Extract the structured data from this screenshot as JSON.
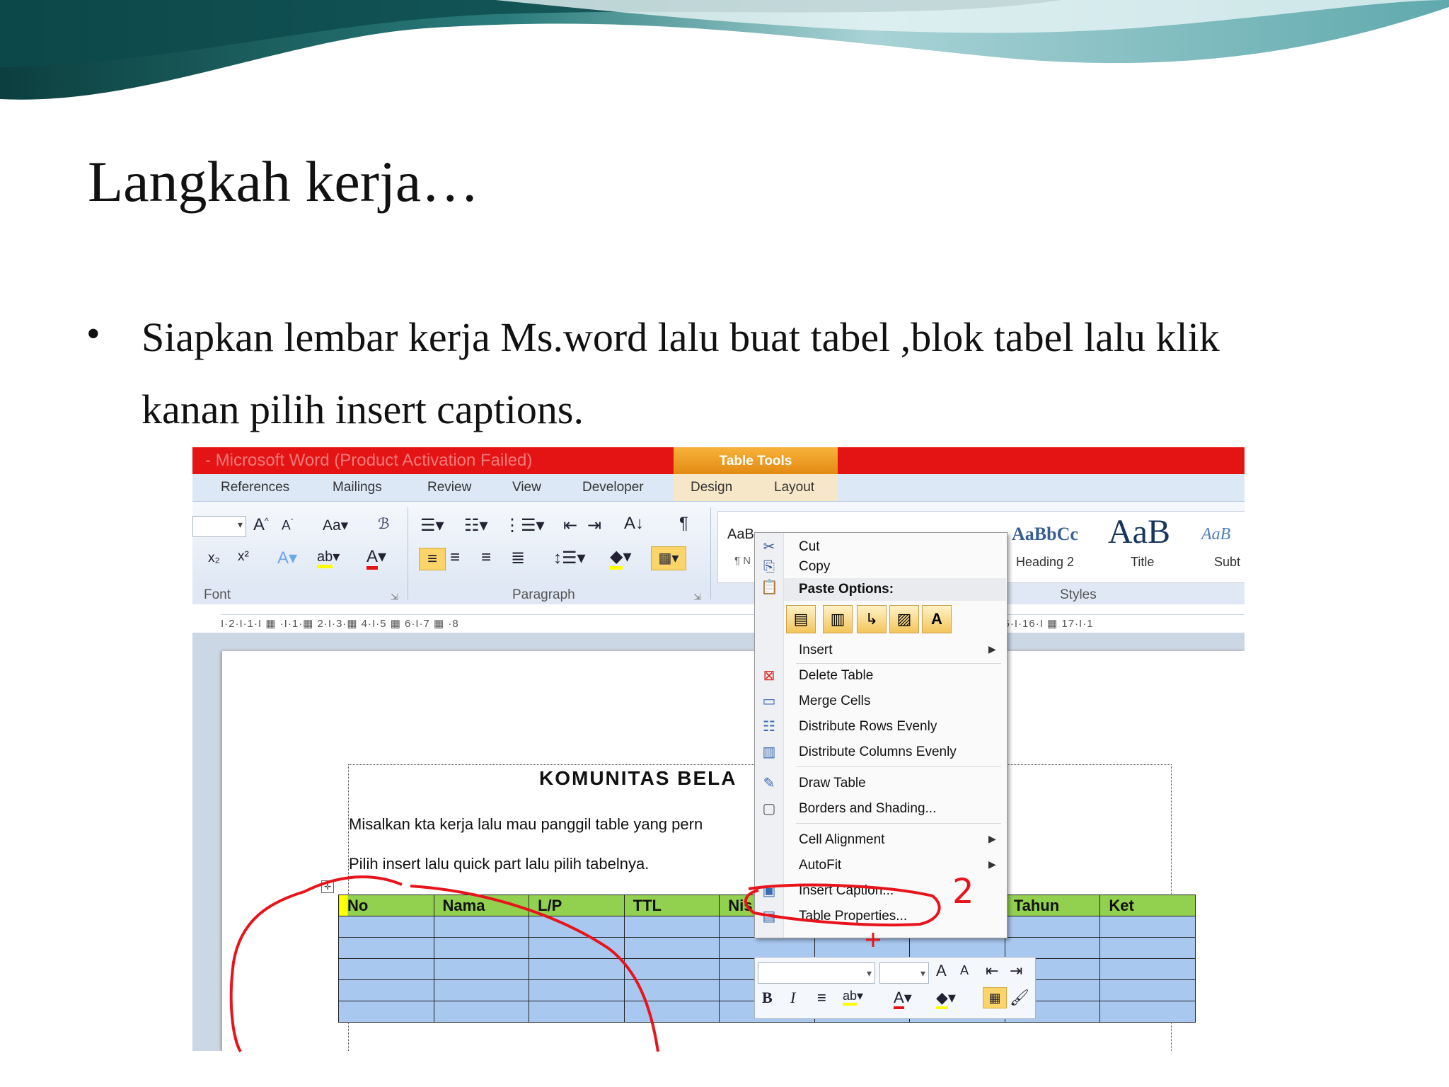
{
  "slide": {
    "title": "Langkah kerja…",
    "bullet_symbol": "•",
    "bullet_line1": "Siapkan lembar kerja Ms.word lalu buat tabel ,blok tabel lalu klik",
    "bullet_line2": "kanan pilih insert captions."
  },
  "word": {
    "title_bar": "- Microsoft Word (Product Activation Failed)",
    "contextual_tab_group": "Table Tools",
    "tabs": [
      "References",
      "Mailings",
      "Review",
      "View",
      "Developer",
      "Design",
      "Layout"
    ],
    "ribbon_groups": [
      "Font",
      "Paragraph",
      "Styles"
    ],
    "styles": [
      {
        "preview": "AaBbCc",
        "name": "Heading 2"
      },
      {
        "preview": "AaB",
        "name": "Title"
      },
      {
        "preview": "AaB",
        "name": "Subt"
      }
    ],
    "style_partial_left": "AaB",
    "style_partial_left2": "¶ N",
    "ruler_text": "I·2·I·1·I ▦ ·I·1·▦ 2·I·3·▦ 4·I·5 ▦ 6·I·7 ▦ ·8",
    "ruler_text_right": "I·14·I ▦ 5·I·16·I ▦ 17·I·1",
    "font_size_value": "",
    "document": {
      "heading": "KOMUNITAS BELA",
      "line1": "Misalkan kta kerja lalu mau panggil table yang pern",
      "line2": "Pilih insert lalu quick part lalu pilih tabelnya.",
      "table_headers": [
        "No",
        "Nama",
        "L/P",
        "TTL",
        "Nis",
        "",
        "",
        "Tahun",
        "Ket"
      ],
      "empty_rows": 5
    },
    "context_menu": {
      "items_top": [
        {
          "label": "Cut",
          "icon": "scissors-icon"
        },
        {
          "label": "Copy",
          "icon": "copy-icon"
        }
      ],
      "paste_options_label": "Paste Options:",
      "paste_buttons": [
        "keep-source-formatting-icon",
        "merge-formatting-icon",
        "paste-nested-table-icon",
        "paste-picture-icon",
        "keep-text-only-icon"
      ],
      "items": [
        {
          "label": "Insert",
          "submenu": true,
          "icon": ""
        },
        {
          "label": "Delete Table",
          "submenu": false,
          "icon": "delete-table-icon"
        },
        {
          "label": "Merge Cells",
          "submenu": false,
          "icon": "merge-cells-icon"
        },
        {
          "label": "Distribute Rows Evenly",
          "submenu": false,
          "icon": "distribute-rows-icon"
        },
        {
          "label": "Distribute Columns Evenly",
          "submenu": false,
          "icon": "distribute-columns-icon"
        },
        {
          "label": "Draw Table",
          "submenu": false,
          "icon": "draw-table-icon"
        },
        {
          "label": "Borders and Shading...",
          "submenu": false,
          "icon": "borders-icon"
        },
        {
          "label": "Cell Alignment",
          "submenu": true,
          "icon": ""
        },
        {
          "label": "AutoFit",
          "submenu": true,
          "icon": ""
        },
        {
          "label": "Insert Caption...",
          "submenu": false,
          "icon": "insert-caption-icon"
        },
        {
          "label": "Table Properties...",
          "submenu": false,
          "icon": "table-properties-icon"
        }
      ]
    },
    "annotation_number": "2",
    "annotation_color": "#e8141c"
  }
}
